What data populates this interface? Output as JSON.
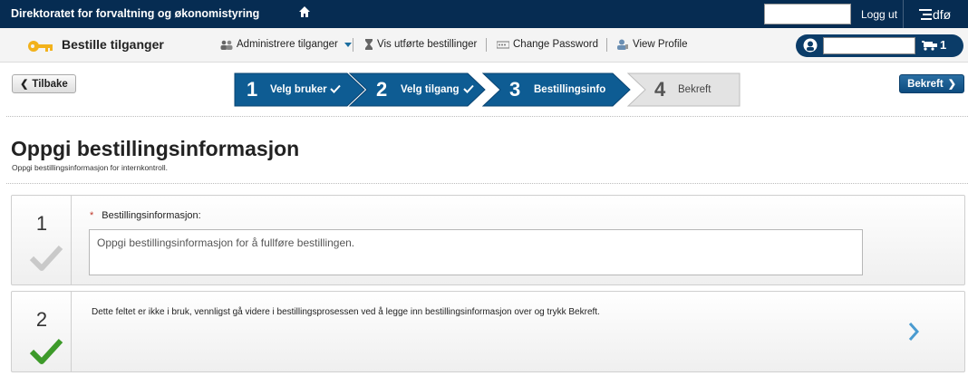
{
  "topbar": {
    "org_name": "Direktoratet for forvaltning og økonomistyring",
    "login_value": "",
    "logout_label": "Logg ut",
    "logo_text": "dfø"
  },
  "navbar": {
    "app_title": "Bestille tilganger",
    "items": [
      {
        "label": "Administrere tilganger",
        "icon": "users-icon"
      },
      {
        "label": "Vis utførte bestillinger",
        "icon": "hourglass-icon"
      },
      {
        "label": "Change Password",
        "icon": "password-icon"
      },
      {
        "label": "View Profile",
        "icon": "profile-icon"
      }
    ],
    "cart_search_value": "",
    "cart_count": "1"
  },
  "stepbar": {
    "back_label": "Tilbake",
    "confirm_label": "Bekreft",
    "steps": [
      {
        "num": "1",
        "label": "Velg bruker",
        "done": true
      },
      {
        "num": "2",
        "label": "Velg tilgang",
        "done": true
      },
      {
        "num": "3",
        "label": "Bestillingsinfo",
        "done": false
      },
      {
        "num": "4",
        "label": "Bekreft",
        "done": false
      }
    ],
    "colors": {
      "active": "#0e5c93",
      "inactive": "#e3e3e3"
    }
  },
  "page": {
    "title": "Oppgi bestillingsinformasjon",
    "subtitle": "Oppgi bestillingsinformasjon for internkontroll."
  },
  "panels": [
    {
      "num": "1",
      "required_mark": "*",
      "field_label": "Bestillingsinformasjon:",
      "placeholder": "Oppgi bestillingsinformasjon for å fullføre bestillingen.",
      "status": "pending"
    },
    {
      "num": "2",
      "text": "Dette feltet er ikke i bruk, vennligst gå videre i bestillingsprosessen ved å legge inn bestillingsinformasjon over og trykk Bekreft.",
      "status": "complete"
    }
  ]
}
